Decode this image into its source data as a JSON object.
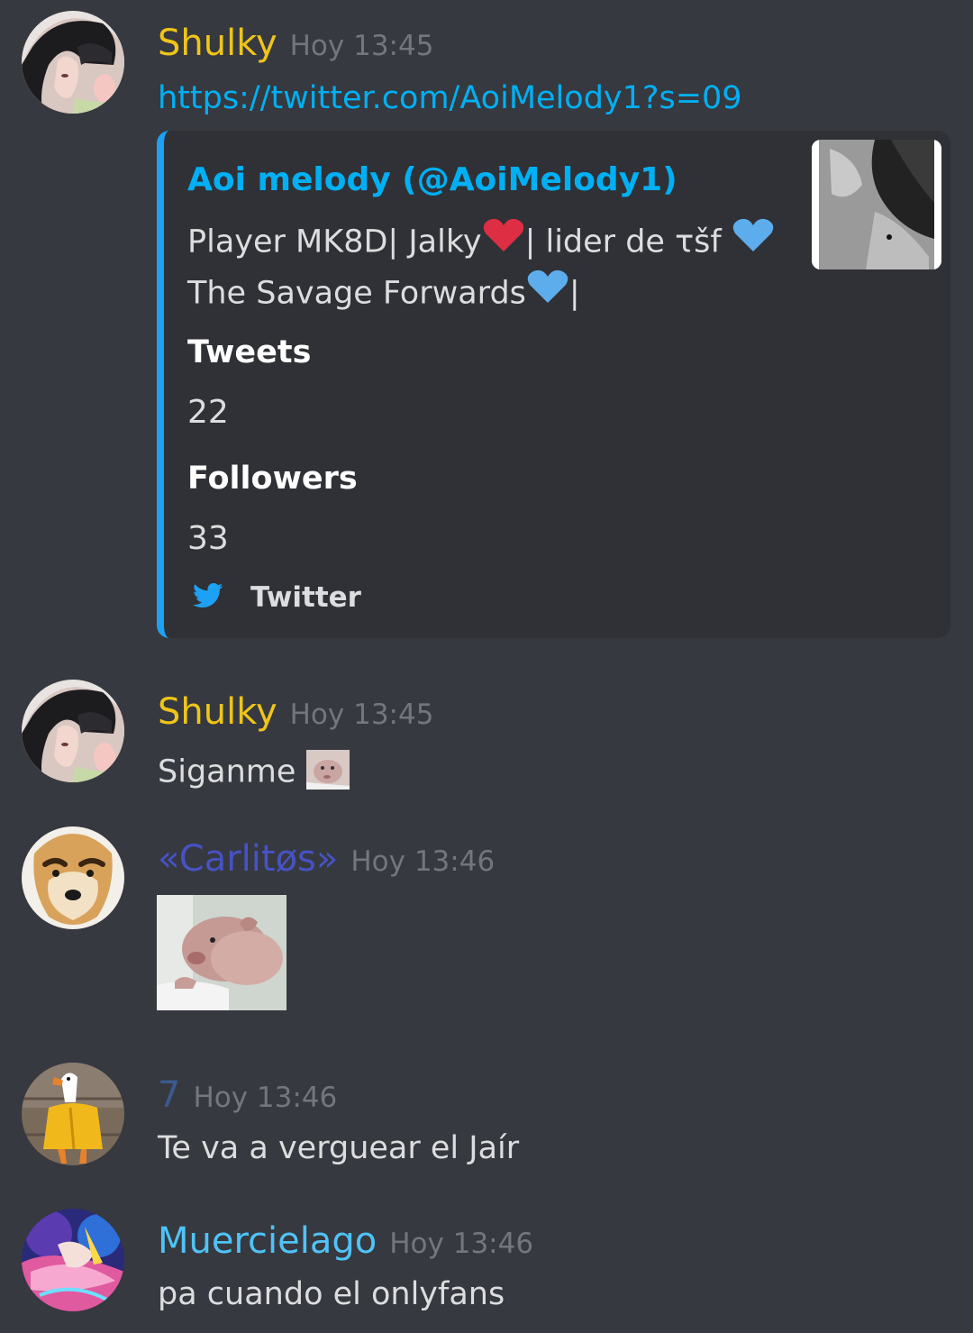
{
  "messages": [
    {
      "username": "Shulky",
      "username_color": "#f0c419",
      "timestamp": "Hoy 13:45",
      "link": "https://twitter.com/AoiMelody1?s=09",
      "avatar_icon": "anime-girl-avatar",
      "embed": {
        "accent_color": "#1da1f2",
        "author": "Aoi melody (@AoiMelody1)",
        "description_line1_a": "Player MK8D| Jalky",
        "description_line1_b": "| lider de τšf",
        "description_line2_a": "The Savage Forwards",
        "description_line2_b": "|",
        "fields": [
          {
            "name": "Tweets",
            "value": "22"
          },
          {
            "name": "Followers",
            "value": "33"
          }
        ],
        "footer": "Twitter",
        "footer_icon": "twitter-bird-icon"
      }
    },
    {
      "username": "Shulky",
      "username_color": "#f0c419",
      "timestamp": "Hoy 13:45",
      "text": "Siganme",
      "avatar_icon": "anime-girl-avatar",
      "inline_emoji": "wombat-emoji"
    },
    {
      "username": "«Carlitøs»",
      "username_color": "#4752c4",
      "timestamp": "Hoy 13:46",
      "avatar_icon": "dog-with-eyebrows-avatar",
      "attachment": "baby-wombat-image"
    },
    {
      "username": "7",
      "username_color": "#3b5b8f",
      "timestamp": "Hoy 13:46",
      "text": "Te va a verguear el Jaír",
      "avatar_icon": "goose-in-yellow-shirt-avatar"
    },
    {
      "username": "Muercielago",
      "username_color": "#4fc3f7",
      "timestamp": "Hoy 13:46",
      "text": "pa cuando el onlyfans",
      "avatar_icon": "colorful-anime-avatar"
    }
  ]
}
